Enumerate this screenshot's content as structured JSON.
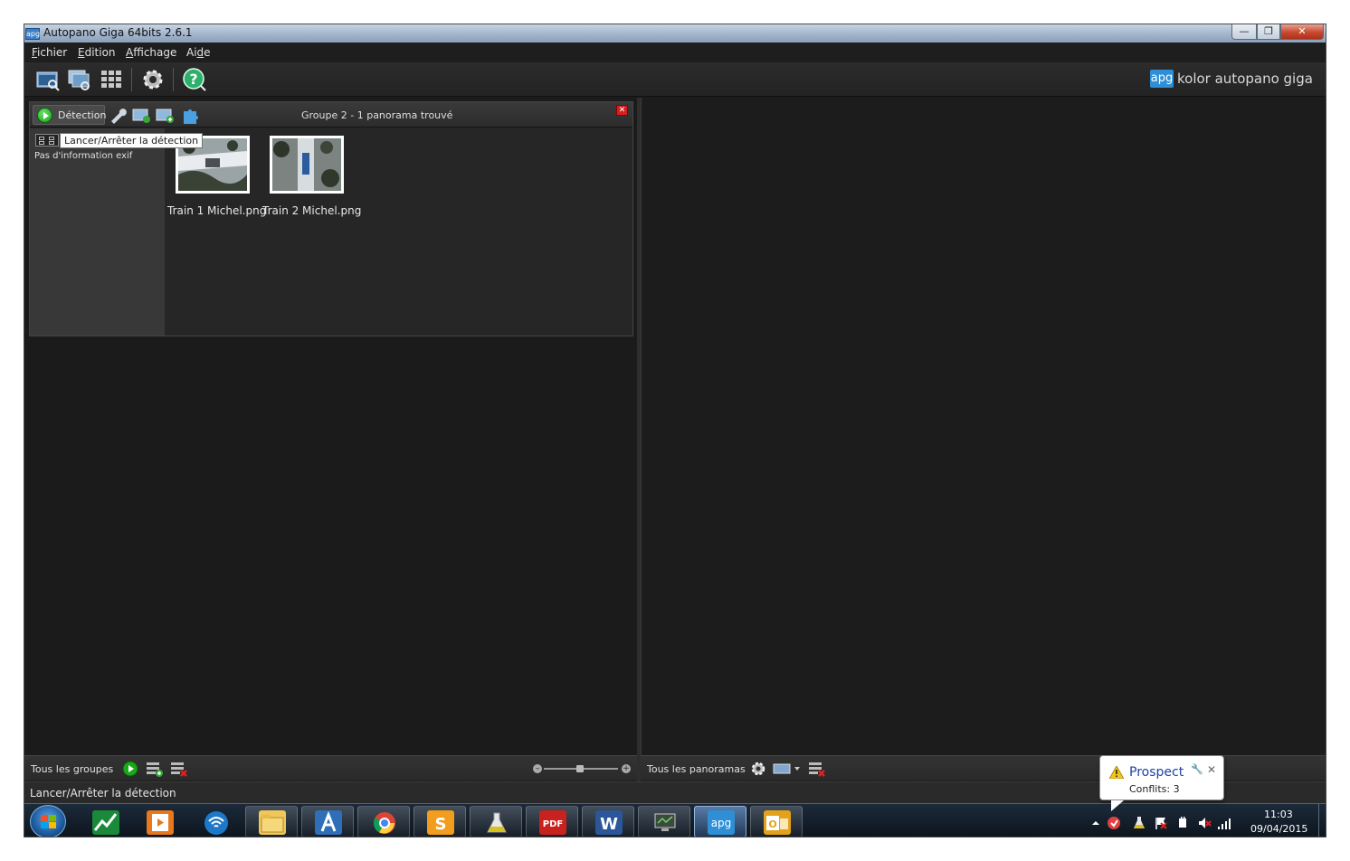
{
  "window": {
    "title": "Autopano Giga 64bits 2.6.1",
    "app_icon_text": "apg",
    "controls": {
      "minimize": "—",
      "maximize": "❐",
      "close": "✕"
    }
  },
  "menu": {
    "items": [
      {
        "first": "F",
        "rest": "ichier"
      },
      {
        "first": "E",
        "rest": "dition"
      },
      {
        "first": "A",
        "rest": "ffichage"
      },
      {
        "first": "",
        "pre": "Ai",
        "u": "d",
        "post": "e"
      }
    ]
  },
  "toolbar": {
    "icons": [
      "open-folder-icon",
      "import-images-icon",
      "grid-detect-icon",
      "settings-gear-icon",
      "help-icon"
    ]
  },
  "brand": {
    "badge": "apg",
    "text": "kolor autopano giga"
  },
  "group_panel": {
    "detection_label": "Détection",
    "title": "Groupe 2 - 1 panorama trouvé",
    "tooltip": "Lancer/Arrêter la détection",
    "exif_info": "Pas d'information exif",
    "close_glyph": "✕",
    "images": [
      {
        "label": "Train 1 Michel.png"
      },
      {
        "label": "Train 2 Michel.png"
      }
    ]
  },
  "bottom_left": {
    "label": "Tous les groupes"
  },
  "bottom_right": {
    "label": "Tous les panoramas"
  },
  "status": {
    "text": "Lancer/Arrêter la détection"
  },
  "balloon": {
    "title": "Prospect",
    "text": "Conflits: 3",
    "close": "✕",
    "pin": "🔧"
  },
  "clock": {
    "time": "11:03",
    "date": "09/04/2015"
  },
  "colors": {
    "accent": "#2e8fd6",
    "play_green": "#17a117",
    "close_red": "#d42020"
  }
}
